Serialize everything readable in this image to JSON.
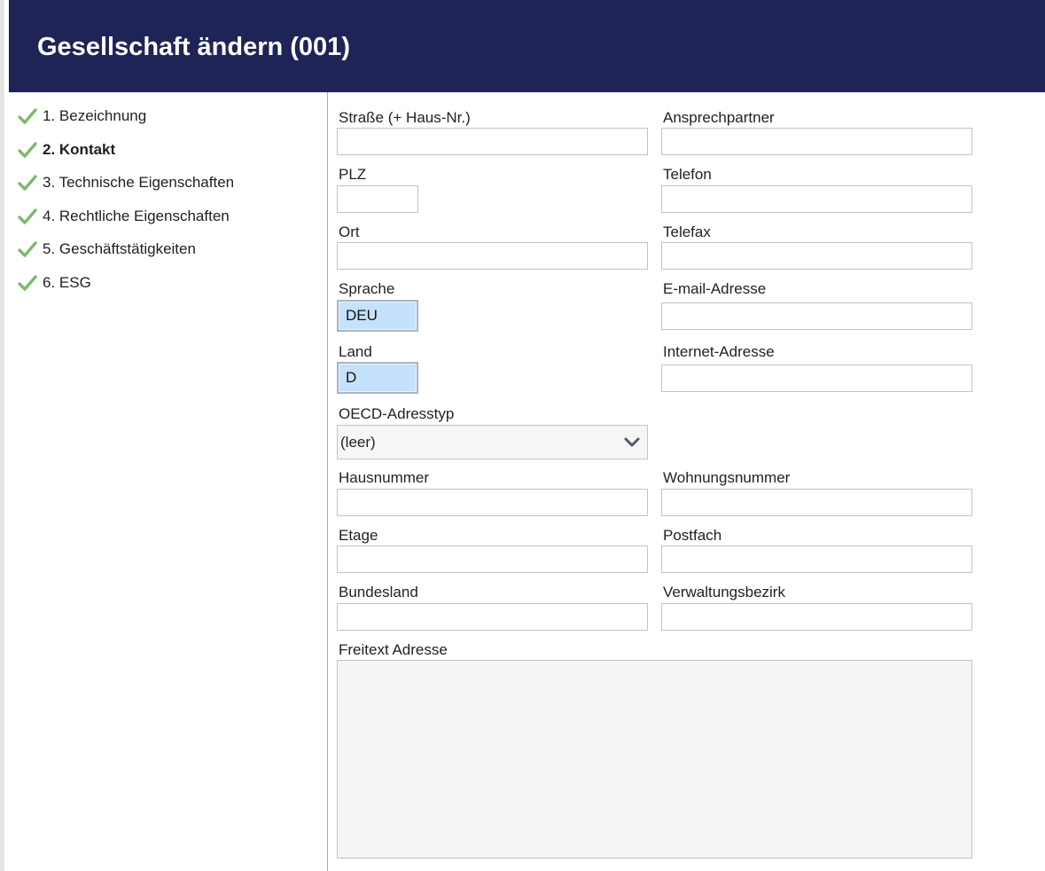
{
  "header": {
    "title": "Gesellschaft ändern (001)"
  },
  "steps": [
    {
      "label": "1. Bezeichnung",
      "active": false
    },
    {
      "label": "2. Kontakt",
      "active": true
    },
    {
      "label": "3. Technische Eigenschaften",
      "active": false
    },
    {
      "label": "4. Rechtliche Eigenschaften",
      "active": false
    },
    {
      "label": "5. Geschäftstätigkeiten",
      "active": false
    },
    {
      "label": "6. ESG",
      "active": false
    }
  ],
  "icons": {
    "step_check": "check-icon",
    "select_toggle": "chevron-down-icon"
  },
  "colors": {
    "header_bg": "#1f2456",
    "check": "#7cba6a",
    "code_field_bg": "#c6e1fb"
  },
  "form": {
    "strasse": {
      "label": "Straße (+ Haus-Nr.)",
      "value": ""
    },
    "ansprechpartner": {
      "label": "Ansprechpartner",
      "value": ""
    },
    "plz": {
      "label": "PLZ",
      "value": ""
    },
    "telefon": {
      "label": "Telefon",
      "value": ""
    },
    "ort": {
      "label": "Ort",
      "value": ""
    },
    "telefax": {
      "label": "Telefax",
      "value": ""
    },
    "sprache": {
      "label": "Sprache",
      "value": "DEU"
    },
    "email": {
      "label": "E-mail-Adresse",
      "value": ""
    },
    "land": {
      "label": "Land",
      "value": "D"
    },
    "internet": {
      "label": "Internet-Adresse",
      "value": ""
    },
    "oecd": {
      "label": "OECD-Adresstyp",
      "value": "(leer)"
    },
    "hausnummer": {
      "label": "Hausnummer",
      "value": ""
    },
    "wohnungsnummer": {
      "label": "Wohnungsnummer",
      "value": ""
    },
    "etage": {
      "label": "Etage",
      "value": ""
    },
    "postfach": {
      "label": "Postfach",
      "value": ""
    },
    "bundesland": {
      "label": "Bundesland",
      "value": ""
    },
    "verwaltungsbezirk": {
      "label": "Verwaltungsbezirk",
      "value": ""
    },
    "freitext": {
      "label": "Freitext Adresse",
      "value": ""
    }
  }
}
